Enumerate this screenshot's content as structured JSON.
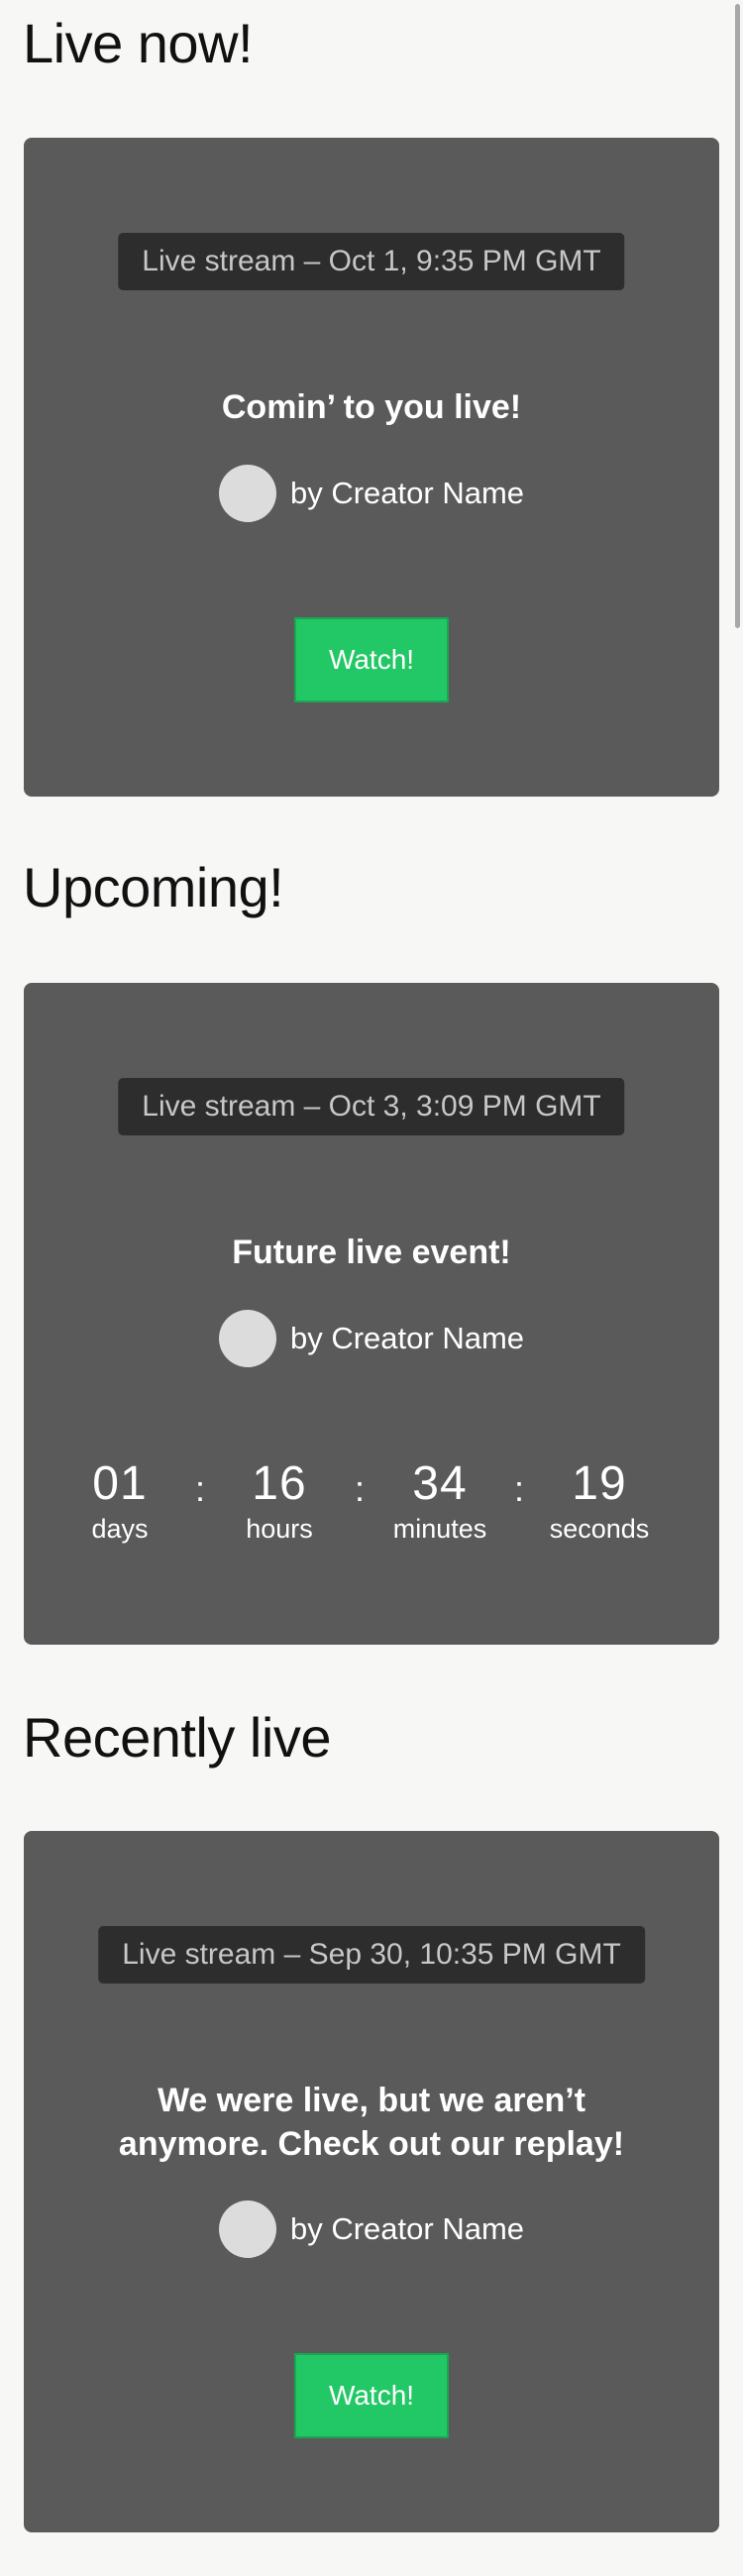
{
  "sections": {
    "live": {
      "title": "Live now!",
      "date": "Live stream – Oct 1, 9:35 PM GMT",
      "headline": "Comin’ to you live!",
      "creator": "by Creator Name",
      "button": "Watch!"
    },
    "upcoming": {
      "title": "Upcoming!",
      "date": "Live stream – Oct 3, 3:09 PM GMT",
      "headline": "Future live event!",
      "creator": "by Creator Name",
      "countdown": {
        "days": "01",
        "days_label": "days",
        "hours": "16",
        "hours_label": "hours",
        "minutes": "34",
        "minutes_label": "minutes",
        "seconds": "19",
        "seconds_label": "seconds",
        "separator": ":"
      }
    },
    "recent": {
      "title": "Recently live",
      "date": "Live stream – Sep 30, 10:35 PM GMT",
      "headline_line1": "We were live, but we aren’t",
      "headline_line2": "anymore. Check out our replay!",
      "creator": "by Creator Name",
      "button": "Watch!"
    }
  },
  "colors": {
    "card": "#5a5a5a",
    "pill": "#2d2d2d",
    "accent": "#22c865",
    "avatar": "#dcdcdc"
  }
}
